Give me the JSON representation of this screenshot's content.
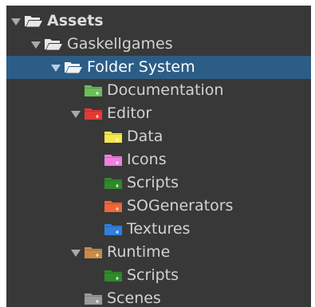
{
  "project_tree": {
    "items": [
      {
        "label": "Assets",
        "depth": 0,
        "expanded": true,
        "icon": "folder-open-icon",
        "color": "#e8e8e8",
        "bold": true,
        "selected": false,
        "has_arrow": true
      },
      {
        "label": "Gaskellgames",
        "depth": 1,
        "expanded": true,
        "icon": "folder-open-icon",
        "color": "#e8e8e8",
        "bold": false,
        "selected": false,
        "has_arrow": true
      },
      {
        "label": "Folder System",
        "depth": 2,
        "expanded": true,
        "icon": "folder-open-icon",
        "color": "#f2f2f2",
        "bold": false,
        "selected": true,
        "has_arrow": true
      },
      {
        "label": "Documentation",
        "depth": 3,
        "expanded": false,
        "icon": "folder-icon",
        "color": "#6bbf59",
        "bold": false,
        "selected": false,
        "has_arrow": false
      },
      {
        "label": "Editor",
        "depth": 3,
        "expanded": true,
        "icon": "folder-icon",
        "color": "#e23b34",
        "bold": false,
        "selected": false,
        "has_arrow": true
      },
      {
        "label": "Data",
        "depth": 4,
        "expanded": false,
        "icon": "folder-icon",
        "color": "#f5e84a",
        "bold": false,
        "selected": false,
        "has_arrow": false
      },
      {
        "label": "Icons",
        "depth": 4,
        "expanded": false,
        "icon": "folder-icon",
        "color": "#ef7fe0",
        "bold": false,
        "selected": false,
        "has_arrow": false
      },
      {
        "label": "Scripts",
        "depth": 4,
        "expanded": false,
        "icon": "folder-icon",
        "color": "#2f8a2a",
        "bold": false,
        "selected": false,
        "has_arrow": false
      },
      {
        "label": "SOGenerators",
        "depth": 4,
        "expanded": false,
        "icon": "folder-icon",
        "color": "#f0663a",
        "bold": false,
        "selected": false,
        "has_arrow": false
      },
      {
        "label": "Textures",
        "depth": 4,
        "expanded": false,
        "icon": "folder-icon",
        "color": "#2f7fe0",
        "bold": false,
        "selected": false,
        "has_arrow": false
      },
      {
        "label": "Runtime",
        "depth": 3,
        "expanded": true,
        "icon": "folder-icon",
        "color": "#c98b45",
        "bold": false,
        "selected": false,
        "has_arrow": true
      },
      {
        "label": "Scripts",
        "depth": 4,
        "expanded": false,
        "icon": "folder-icon",
        "color": "#2f8a2a",
        "bold": false,
        "selected": false,
        "has_arrow": false
      },
      {
        "label": "Scenes",
        "depth": 3,
        "expanded": false,
        "icon": "folder-icon",
        "color": "#9b9b9b",
        "bold": false,
        "selected": false,
        "has_arrow": false
      }
    ]
  }
}
